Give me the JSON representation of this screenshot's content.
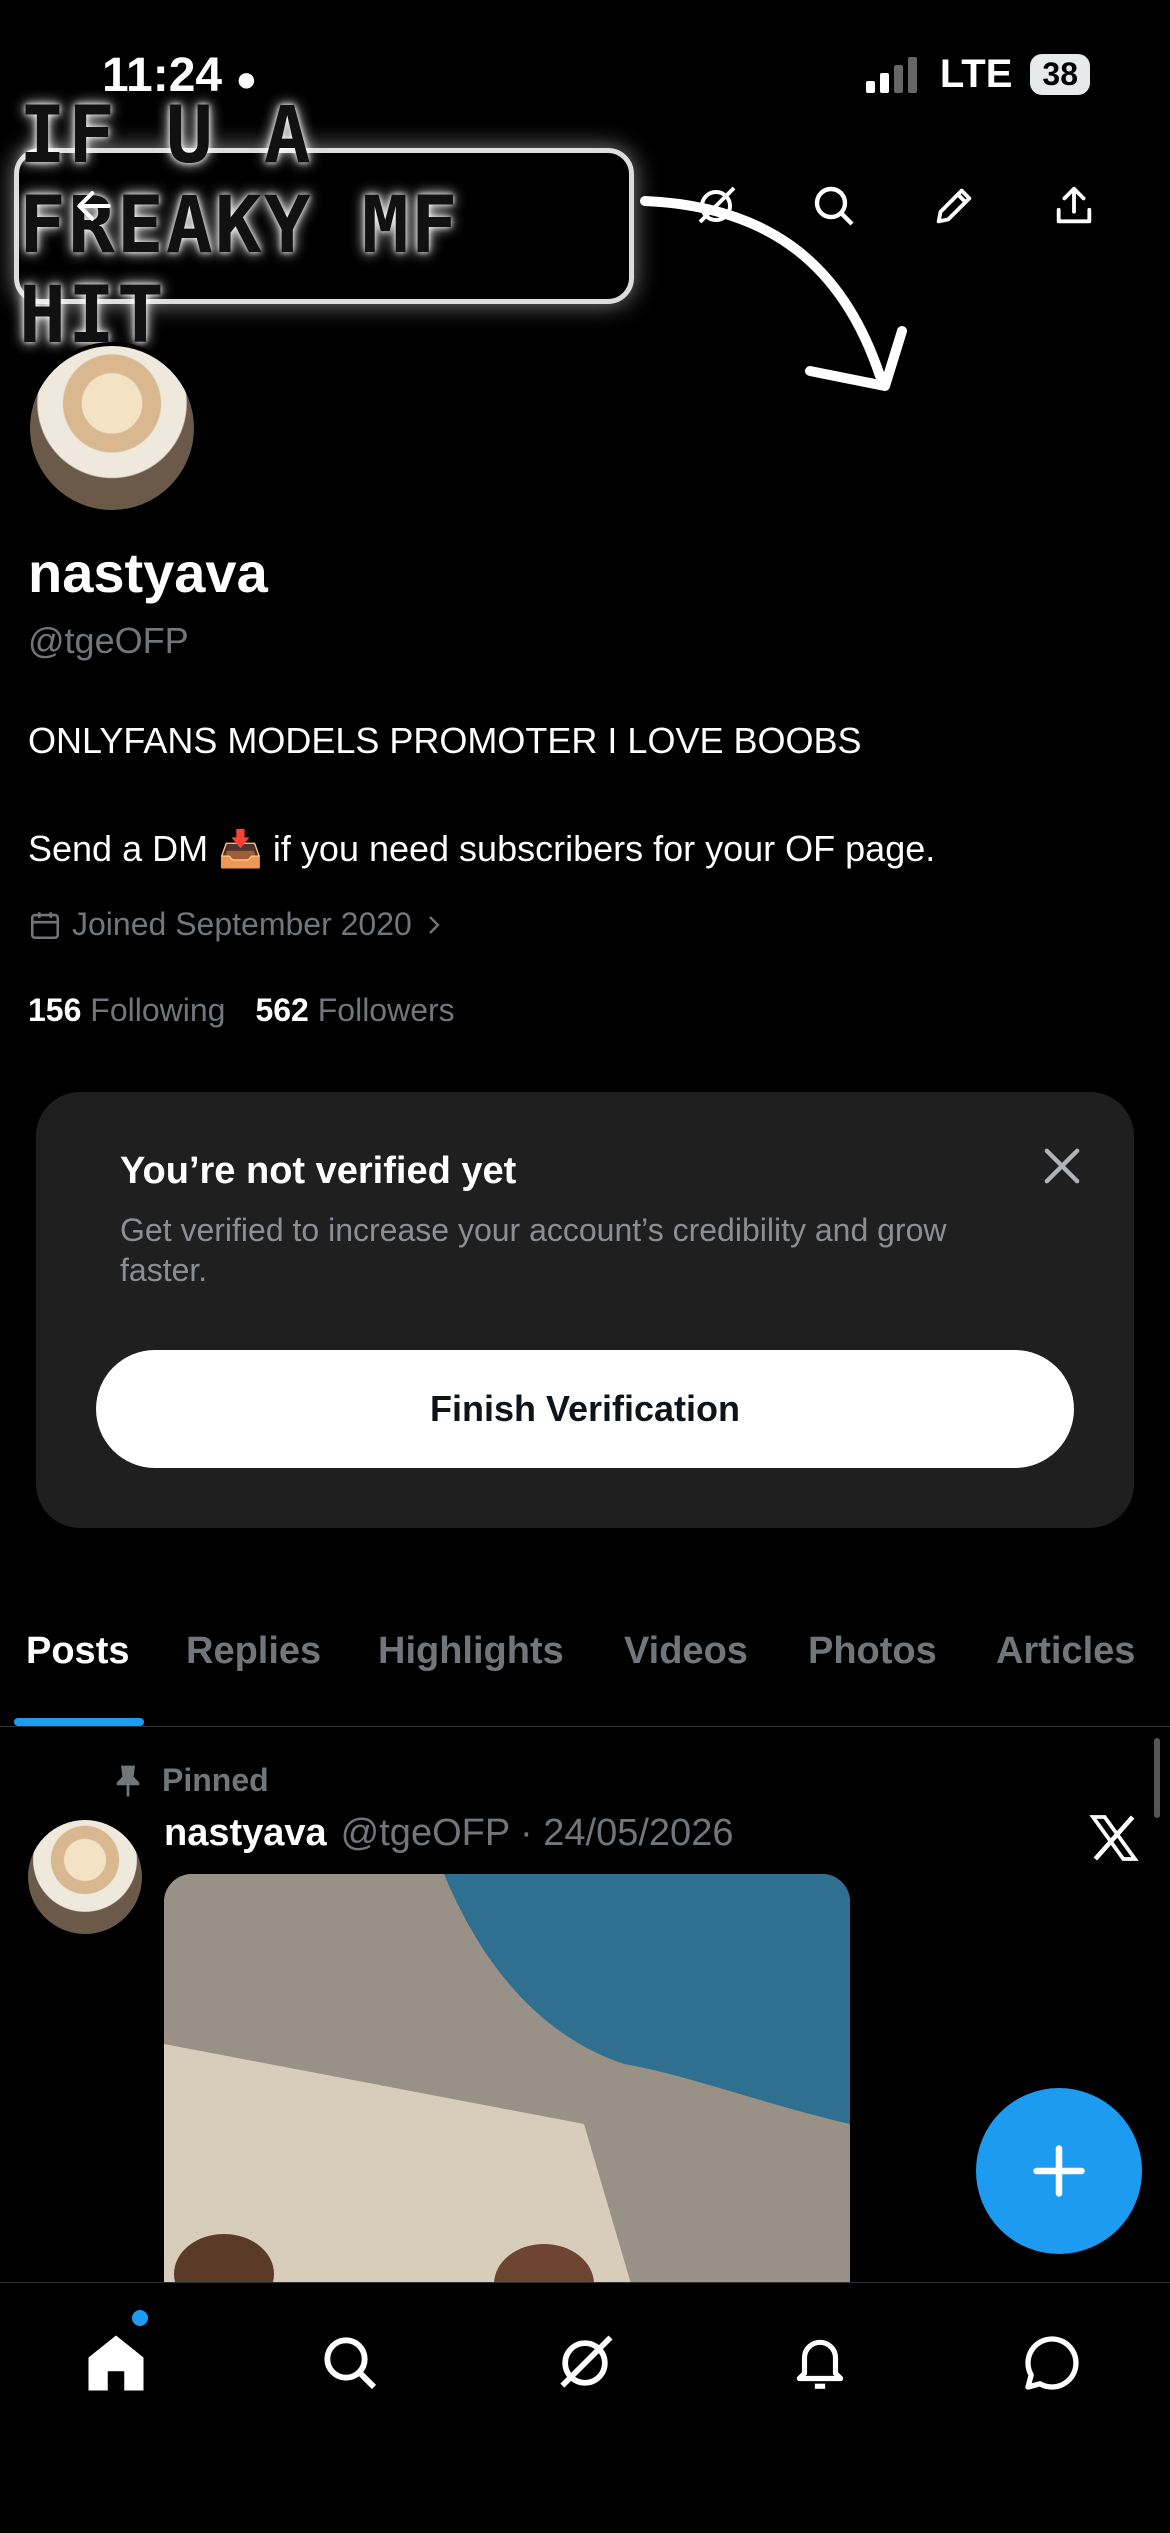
{
  "status_bar": {
    "time": "11:24",
    "network": "LTE",
    "battery": "38"
  },
  "banner": {
    "sign_text": "IF U A FREAKY MF HIT"
  },
  "header": {
    "icons": [
      "back-arrow-icon",
      "grok-icon",
      "search-icon",
      "edit-icon",
      "share-icon"
    ]
  },
  "profile": {
    "name": "nastyava",
    "handle": "@tgeOFP",
    "bio_line1": "ONLYFANS MODELS PROMOTER I LOVE BOOBS",
    "bio_line2_prefix": "Send a DM",
    "bio_emoji": "📥",
    "bio_line2_suffix": "if you need subscribers for your OF page.",
    "joined": "Joined September 2020",
    "following_count": "156",
    "following_label": "Following",
    "followers_count": "562",
    "followers_label": "Followers"
  },
  "verification_card": {
    "title": "You’re not verified yet",
    "description": "Get verified to increase your account’s credibility and grow faster.",
    "button": "Finish Verification"
  },
  "tabs": [
    "Posts",
    "Replies",
    "Highlights",
    "Videos",
    "Photos",
    "Articles"
  ],
  "active_tab": "Posts",
  "post": {
    "pinned_label": "Pinned",
    "name": "nastyava",
    "meta": "@tgeOFP · 24/05/2026"
  },
  "colors": {
    "accent": "#1d9bf0",
    "background": "#000000",
    "card": "#1f1f1f",
    "muted": "#71767b"
  },
  "bottom_nav": [
    "home-icon",
    "search-icon",
    "grok-icon",
    "notifications-icon",
    "messages-icon"
  ]
}
